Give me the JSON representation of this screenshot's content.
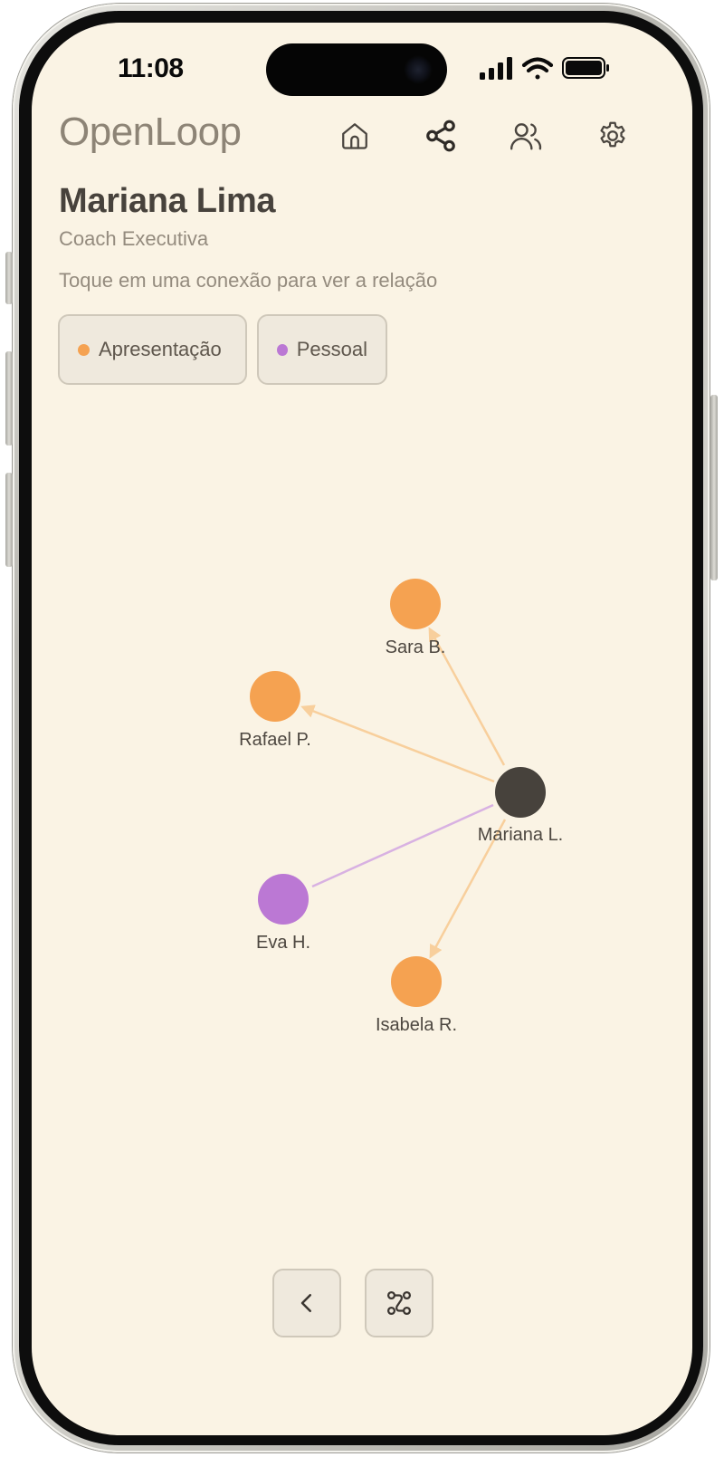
{
  "status_bar": {
    "time": "11:08",
    "icons": [
      "signal-icon",
      "wifi-icon",
      "battery-icon"
    ]
  },
  "header": {
    "brand": "OpenLoop",
    "nav": [
      {
        "name": "home-icon"
      },
      {
        "name": "share-icon"
      },
      {
        "name": "users-icon"
      },
      {
        "name": "settings-icon"
      }
    ]
  },
  "profile": {
    "name": "Mariana Lima",
    "role": "Coach Executiva",
    "hint": "Toque em uma conexão para ver a relação"
  },
  "legend": [
    {
      "label": "Apresentação",
      "color": "#f5a251"
    },
    {
      "label": "Pessoal",
      "color": "#bb78d4"
    }
  ],
  "graph": {
    "center": {
      "label": "Mariana L.",
      "color": "#47423c"
    },
    "nodes": [
      {
        "label": "Sara B.",
        "type": "Apresentação",
        "color": "#f5a251"
      },
      {
        "label": "Rafael P.",
        "type": "Apresentação",
        "color": "#f5a251"
      },
      {
        "label": "Eva H.",
        "type": "Pessoal",
        "color": "#bb78d4"
      },
      {
        "label": "Isabela R.",
        "type": "Apresentação",
        "color": "#f5a251"
      }
    ],
    "edge_colors": {
      "Apresentação": "#f8cf9c",
      "Pessoal": "#d8b1e2"
    }
  },
  "bottom_bar": {
    "buttons": [
      {
        "name": "back-chevron-icon"
      },
      {
        "name": "graph-layout-icon"
      }
    ]
  }
}
